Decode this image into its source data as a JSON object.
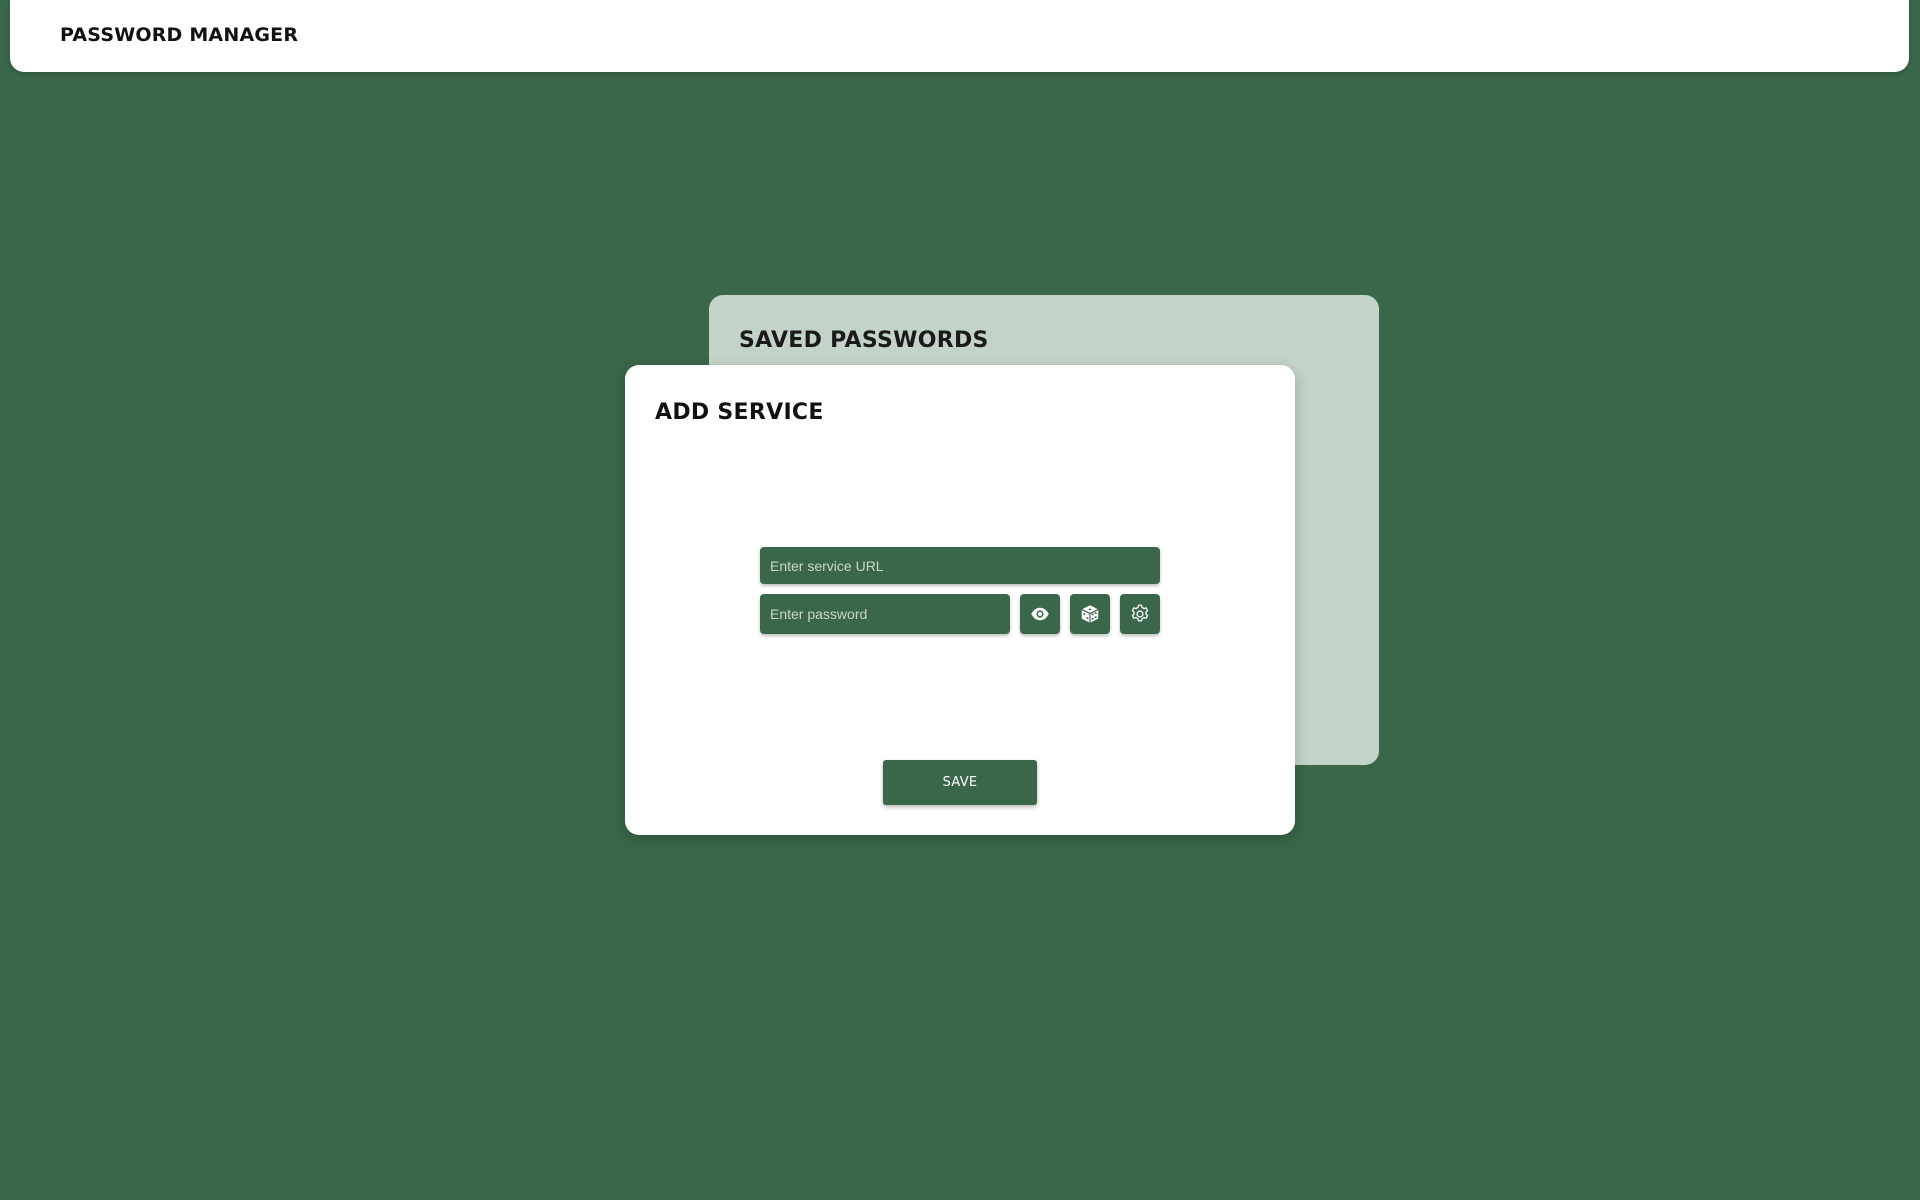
{
  "header": {
    "title": "PASSWORD MANAGER"
  },
  "saved_panel": {
    "title": "SAVED PASSWORDS"
  },
  "add_panel": {
    "title": "ADD SERVICE",
    "url_placeholder": "Enter service URL",
    "url_value": "",
    "password_placeholder": "Enter password",
    "password_value": "",
    "icons": {
      "toggle_visibility": "eye-icon",
      "generate": "dice-icon",
      "settings": "gear-icon"
    },
    "save_label": "SAVE"
  },
  "colors": {
    "background": "#3a6749",
    "accent": "#3a6749",
    "card": "#ffffff",
    "saved_card": "#c4d3c9"
  }
}
